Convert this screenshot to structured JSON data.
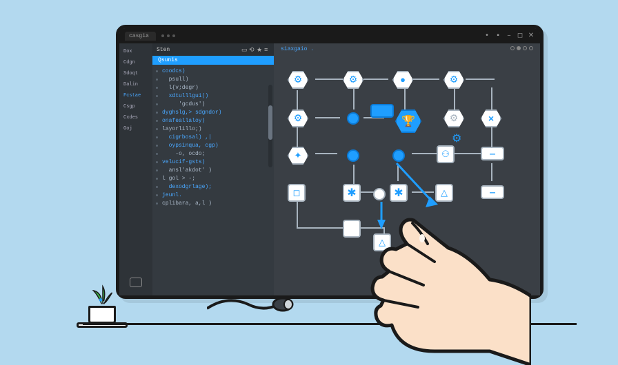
{
  "titlebar": {
    "tab": "casgia"
  },
  "window_controls": {
    "min": "–",
    "max": "◻",
    "close": "✕"
  },
  "sidebar": {
    "items": [
      {
        "label": "Dox"
      },
      {
        "label": "Cdgn"
      },
      {
        "label": "Sdoqt"
      },
      {
        "label": "Dalin"
      },
      {
        "label": "Fcstae"
      },
      {
        "label": "Csgp"
      },
      {
        "label": "Cxdes"
      },
      {
        "label": "Goj"
      }
    ]
  },
  "editor": {
    "header": "Sten",
    "file": "Qsunis",
    "lines": [
      "coodcs)",
      "  psull)",
      "  l{v;degr)",
      "  xdtulllgui()",
      "     'gcdus')",
      "dyghslg,> sdgndor)",
      "onafeallaloy)",
      "layorlillo;)",
      "  cigrbosal) ,|",
      "  oypsinqua, cgp)",
      "    -o, ocdo;",
      "velucif-gsts)",
      "  ansl'akdot' )",
      "l gol > -;",
      "  dexodgrlage);",
      "jeunl.",
      "cplibara, a,l )"
    ]
  },
  "canvas": {
    "title": "siaxgaio  ."
  },
  "icons": {
    "gear": "⚙",
    "star": "✱",
    "asterisk": "✱",
    "cross": "✕",
    "minus": "—",
    "triangle": "△",
    "trophy": "🏆",
    "sparkle": "✦",
    "square": "◻",
    "dot": "●",
    "person": "⚇"
  }
}
